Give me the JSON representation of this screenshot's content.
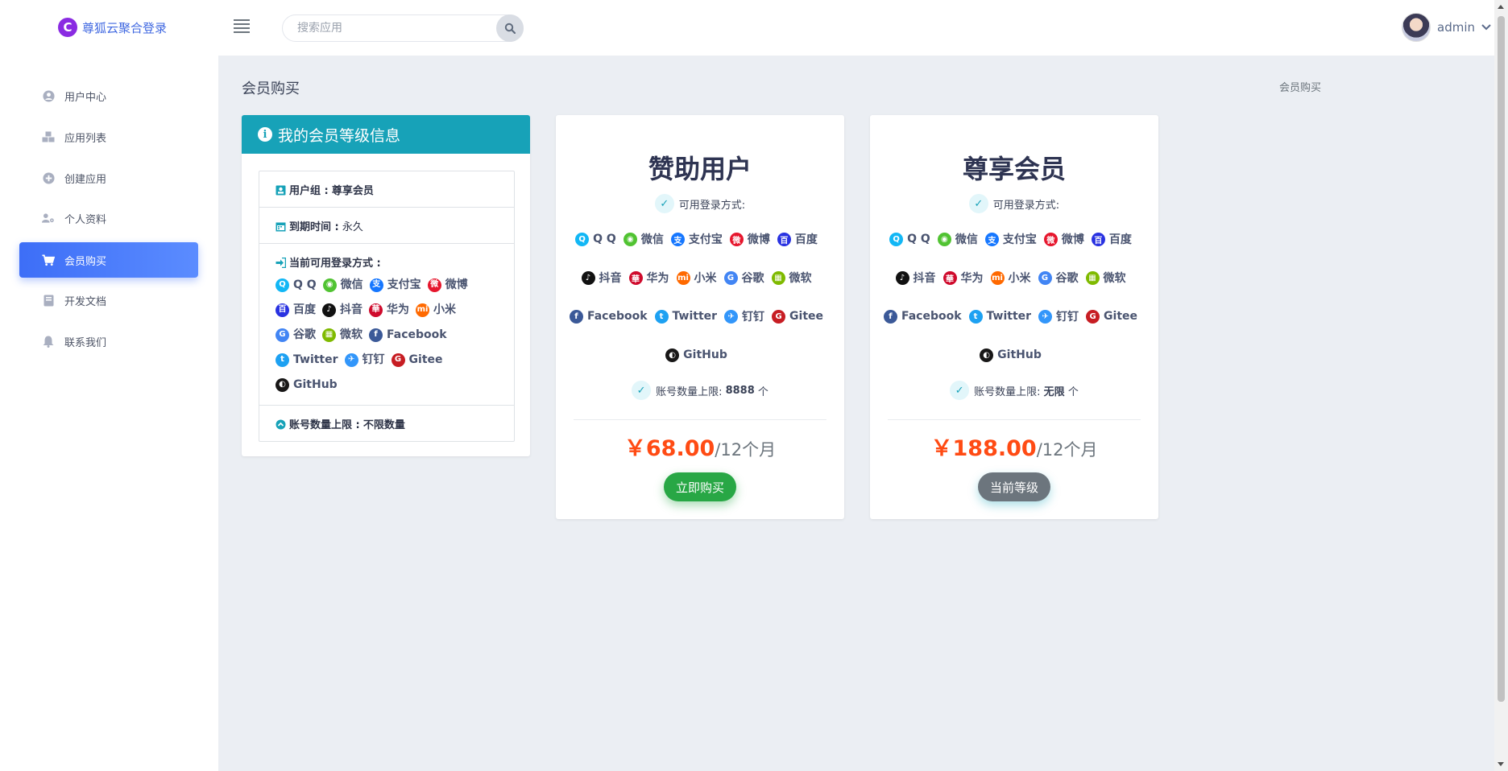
{
  "app": {
    "name": "尊狐云聚合登录",
    "logo_letter": "C"
  },
  "header": {
    "search_placeholder": "搜索应用",
    "username": "admin"
  },
  "sidebar": {
    "items": [
      {
        "label": "用户中心",
        "icon": "user-circle-icon"
      },
      {
        "label": "应用列表",
        "icon": "cubes-icon"
      },
      {
        "label": "创建应用",
        "icon": "plus-circle-icon"
      },
      {
        "label": "个人资料",
        "icon": "user-gear-icon"
      },
      {
        "label": "会员购买",
        "icon": "cart-icon",
        "active": true
      },
      {
        "label": "开发文档",
        "icon": "book-icon"
      },
      {
        "label": "联系我们",
        "icon": "bell-icon"
      }
    ]
  },
  "page": {
    "title": "会员购买",
    "breadcrumb": "会员购买"
  },
  "info_card": {
    "title": "我的会员等级信息",
    "group_label": "用户组 :",
    "group_value": "尊享会员",
    "expire_label": "到期时间 :",
    "expire_value": "永久",
    "logins_label": "当前可用登录方式 :",
    "limit_label": "账号数量上限 :",
    "limit_value": "不限数量"
  },
  "login_methods": [
    {
      "name": "Q Q",
      "color": "#12b7f5"
    },
    {
      "name": "微信",
      "color": "#51c332"
    },
    {
      "name": "支付宝",
      "color": "#1677ff"
    },
    {
      "name": "微博",
      "color": "#e6162d"
    },
    {
      "name": "百度",
      "color": "#2932e1"
    },
    {
      "name": "抖音",
      "color": "#111111"
    },
    {
      "name": "华为",
      "color": "#cf0a2c"
    },
    {
      "name": "小米",
      "color": "#ff6900"
    },
    {
      "name": "谷歌",
      "color": "#4285f4"
    },
    {
      "name": "微软",
      "color": "#7fba00"
    },
    {
      "name": "Facebook",
      "color": "#3b5998"
    },
    {
      "name": "Twitter",
      "color": "#1da1f2"
    },
    {
      "name": "钉钉",
      "color": "#3296fa"
    },
    {
      "name": "Gitee",
      "color": "#c71d23"
    },
    {
      "name": "GitHub",
      "color": "#181717"
    }
  ],
  "plans": [
    {
      "name": "赞助用户",
      "logins_label": "可用登录方式:",
      "limit_label": "账号数量上限:",
      "limit_value": "8888",
      "limit_unit": "个",
      "price": "￥68.00",
      "period": "/12个月",
      "button": "立即购买"
    },
    {
      "name": "尊享会员",
      "logins_label": "可用登录方式:",
      "limit_label": "账号数量上限:",
      "limit_value": "无限",
      "limit_unit": "个",
      "price": "￥188.00",
      "period": "/12个月",
      "button": "当前等级"
    }
  ]
}
